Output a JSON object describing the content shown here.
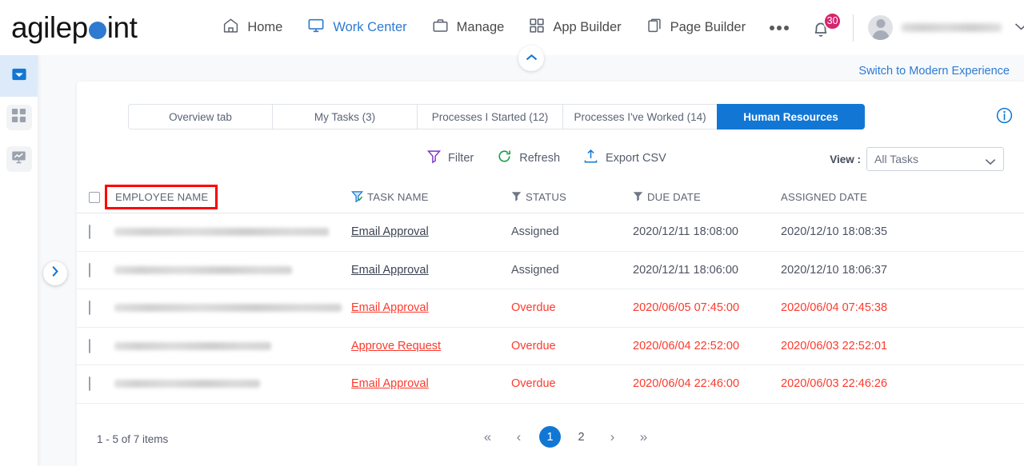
{
  "brand": {
    "name_part1": "agilep",
    "name_part2": "int",
    "dot_color": "#2e7ad1"
  },
  "header": {
    "nav": [
      {
        "label": "Home",
        "icon": "home-icon",
        "active": false
      },
      {
        "label": "Work Center",
        "icon": "monitor-icon",
        "active": true
      },
      {
        "label": "Manage",
        "icon": "briefcase-icon",
        "active": false
      },
      {
        "label": "App Builder",
        "icon": "grid-icon",
        "active": false
      },
      {
        "label": "Page Builder",
        "icon": "page-icon",
        "active": false
      }
    ],
    "more_label": "more-options",
    "notification_count": "30",
    "notification_color": "#d6246e",
    "username": "",
    "avatar_name": "user-avatar"
  },
  "sidebar": {
    "items": [
      {
        "name": "sidebar-item-inbox",
        "icon": "inbox-icon",
        "active": true
      },
      {
        "name": "sidebar-item-apps",
        "icon": "grid-squares-icon",
        "active": false
      },
      {
        "name": "sidebar-item-reports",
        "icon": "chart-monitor-icon",
        "active": false
      }
    ],
    "expand_label": "expand-sidebar"
  },
  "switch_link": "Switch to Modern Experience",
  "tabs": [
    {
      "label": "Overview tab",
      "active": false,
      "width_class": "tab-w1"
    },
    {
      "label": "My Tasks (3)",
      "active": false,
      "width_class": "tab-w2"
    },
    {
      "label": "Processes I Started (12)",
      "active": false,
      "width_class": "tab-w3"
    },
    {
      "label": "Processes I've Worked (14)",
      "active": false,
      "width_class": "tab-w4"
    },
    {
      "label": "Human Resources",
      "active": true,
      "width_class": "tab-w5"
    }
  ],
  "toolbar": {
    "filter_label": "Filter",
    "filter_icon_color": "#7a35c9",
    "refresh_label": "Refresh",
    "refresh_icon_color": "#1a9e4b",
    "export_label": "Export CSV",
    "export_icon_color": "#1277d4",
    "view_label": "View :",
    "view_value": "All Tasks"
  },
  "table": {
    "columns": [
      {
        "label": "EMPLOYEE NAME",
        "filter": false,
        "highlighted": true
      },
      {
        "label": "TASK NAME",
        "filter": true,
        "filter_active": true
      },
      {
        "label": "STATUS",
        "filter": true,
        "filter_active": false
      },
      {
        "label": "DUE DATE",
        "filter": true,
        "filter_active": false
      },
      {
        "label": "ASSIGNED DATE",
        "filter": false,
        "filter_active": false
      }
    ],
    "highlight_color": "#ff0000",
    "rows": [
      {
        "name_width": 268,
        "task": "Email Approval",
        "status": "Assigned",
        "due": "2020/12/11 18:08:00",
        "assigned": "2020/12/10 18:08:35",
        "overdue": false
      },
      {
        "name_width": 222,
        "task": "Email Approval",
        "status": "Assigned",
        "due": "2020/12/11 18:06:00",
        "assigned": "2020/12/10 18:06:37",
        "overdue": false
      },
      {
        "name_width": 284,
        "task": "Email Approval",
        "status": "Overdue",
        "due": "2020/06/05 07:45:00",
        "assigned": "2020/06/04 07:45:38",
        "overdue": true
      },
      {
        "name_width": 196,
        "task": "Approve Request",
        "status": "Overdue",
        "due": "2020/06/04 22:52:00",
        "assigned": "2020/06/03 22:52:01",
        "overdue": true
      },
      {
        "name_width": 182,
        "task": "Email Approval",
        "status": "Overdue",
        "due": "2020/06/04 22:46:00",
        "assigned": "2020/06/03 22:46:26",
        "overdue": true
      }
    ]
  },
  "pagination": {
    "info": "1 - 5 of 7 items",
    "first": "«",
    "prev": "‹",
    "pages": [
      {
        "label": "1",
        "active": true
      },
      {
        "label": "2",
        "active": false
      }
    ],
    "next": "›",
    "last": "»"
  }
}
